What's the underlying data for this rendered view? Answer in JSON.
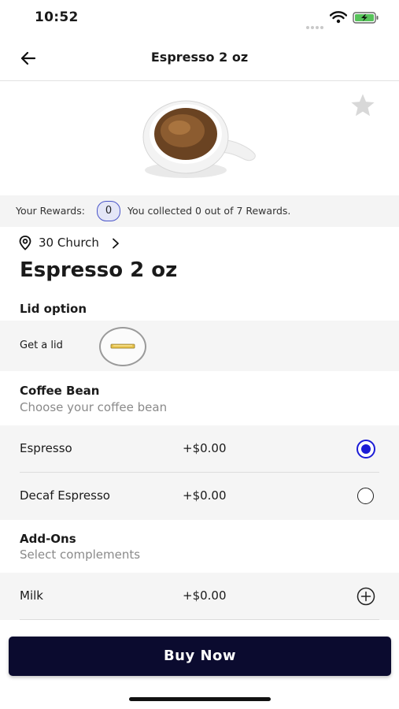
{
  "status_bar": {
    "time": "10:52"
  },
  "header": {
    "title": "Espresso 2 oz"
  },
  "rewards": {
    "label": "Your Rewards:",
    "count": "0",
    "message": "You collected 0 out of 7 Rewards."
  },
  "store": {
    "name": "30 Church"
  },
  "product": {
    "title": "Espresso 2 oz"
  },
  "lid_section": {
    "title": "Lid option",
    "option_label": "Get a lid"
  },
  "coffee_bean": {
    "title": "Coffee Bean",
    "subtitle": "Choose your coffee bean",
    "options": [
      {
        "name": "Espresso",
        "price": "+$0.00",
        "selected": true
      },
      {
        "name": "Decaf Espresso",
        "price": "+$0.00",
        "selected": false
      }
    ]
  },
  "add_ons": {
    "title": "Add-Ons",
    "subtitle": "Select complements",
    "options": [
      {
        "name": "Milk",
        "price": "+$0.00"
      }
    ]
  },
  "footer": {
    "buy_label": "Buy Now"
  },
  "colors": {
    "buy_button": "#0b0b2f",
    "radio_selected": "#1c1cd6",
    "rewards_badge_border": "#4a55c8",
    "lid_icon": "#e8c24a"
  },
  "icons": {
    "back": "arrow-left-icon",
    "favorite": "star-icon",
    "location": "pin-icon",
    "store_chevron": "chevron-right-icon",
    "lid": "lid-icon",
    "add": "plus-circle-icon"
  }
}
